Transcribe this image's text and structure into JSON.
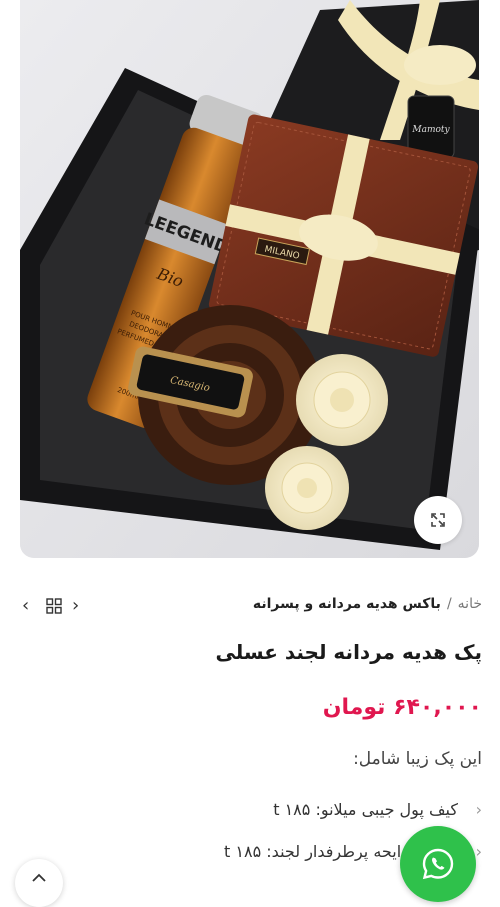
{
  "gallery": {
    "product_image_alt": "",
    "labels": {
      "spray": "LEEGEND",
      "spray_brand": "Bio",
      "spray_line1": "POUR HOMME",
      "spray_line2": "DEODORANT",
      "spray_line3": "PERFUMED SPRAY",
      "spray_size": "200ml",
      "wallet_brand": "MILANO",
      "buckle_brand": "Casagio",
      "tag_text": "Mamoty"
    },
    "zoom_icon": "expand-icon"
  },
  "nav": {
    "prev_icon": "chevron-left-icon",
    "grid_icon": "grid-icon",
    "next_icon": "chevron-right-icon"
  },
  "breadcrumb": {
    "home": "خانه",
    "separator": "/",
    "category": "باکس هدیه مردانه و پسرانه"
  },
  "product": {
    "title": "پک هدیه مردانه لجند عسلی",
    "price": "۶۴۰,۰۰۰ تومان",
    "intro": "این پک زیبا شامل:",
    "items": [
      {
        "text": "کیف پول جیبی میلانو: ۱۸۵ t"
      },
      {
        "text": "اسپری رایحه پرطرفدار لجند: ۱۸۵ t"
      }
    ]
  },
  "colors": {
    "price": "#e0174f",
    "whatsapp": "#2fc14b"
  }
}
